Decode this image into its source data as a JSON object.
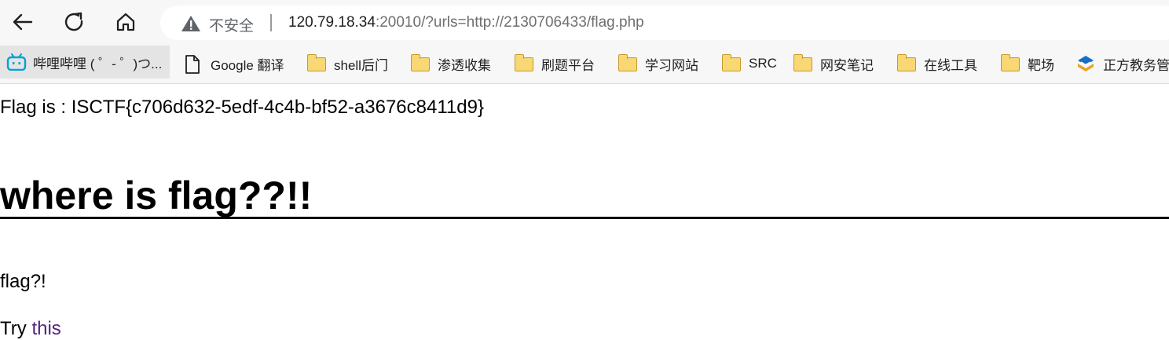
{
  "browser": {
    "security_label": "不安全",
    "url_host": "120.79.18.34",
    "url_rest": ":20010/?urls=http://2130706433/flag.php",
    "bookmarks": [
      {
        "label": "哔哩哔哩 ( ゜- ゜)つ...",
        "icon": "bilibili-icon"
      },
      {
        "label": "Google 翻译",
        "icon": "page-icon"
      },
      {
        "label": "shell后门",
        "icon": "folder-icon"
      },
      {
        "label": "渗透收集",
        "icon": "folder-icon"
      },
      {
        "label": "刷题平台",
        "icon": "folder-icon"
      },
      {
        "label": "学习网站",
        "icon": "folder-icon"
      },
      {
        "label": "SRC",
        "icon": "folder-icon"
      },
      {
        "label": "网安笔记",
        "icon": "folder-icon"
      },
      {
        "label": "在线工具",
        "icon": "folder-icon"
      },
      {
        "label": "靶场",
        "icon": "folder-icon"
      },
      {
        "label": "正方教务管",
        "icon": "zhengfang-icon"
      }
    ]
  },
  "page": {
    "flag_text": "Flag is : ISCTF{c706d632-5edf-4c4b-bf52-a3676c8411d9}",
    "heading": "where is flag??!!",
    "paragraph": "flag?!",
    "try_prefix": "Try ",
    "try_link": "this"
  },
  "colors": {
    "link": "#52237c",
    "folder": "#f8d775",
    "bilibili": "#00a1d6"
  }
}
